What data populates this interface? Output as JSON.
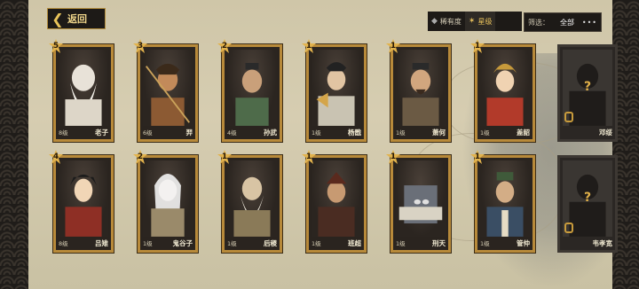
{
  "header": {
    "back_label": "返回",
    "sort_options": [
      {
        "label": "稀有度",
        "icon": "diamond-icon",
        "active": false
      },
      {
        "label": "星级",
        "icon": "star-icon",
        "active": true
      }
    ],
    "filter_label": "筛选：",
    "filter_value": "全部",
    "more_label": "•••"
  },
  "colors": {
    "accent": "#e8c15c",
    "card_frame": "#b88a3a",
    "star_badge": "#e2b34d",
    "panel_bg": "#d6cdb1"
  },
  "cards": [
    {
      "name": "老子",
      "level": "8级",
      "stars": "5",
      "locked": false
    },
    {
      "name": "羿",
      "level": "6级",
      "stars": "3",
      "locked": false
    },
    {
      "name": "孙武",
      "level": "4级",
      "stars": "2",
      "locked": false
    },
    {
      "name": "杨戬",
      "level": "1级",
      "stars": "1",
      "locked": false
    },
    {
      "name": "萧何",
      "level": "1级",
      "stars": "1",
      "locked": false
    },
    {
      "name": "盖韶",
      "level": "1级",
      "stars": "1",
      "locked": false
    },
    {
      "name": "邓绥",
      "level": "",
      "stars": "",
      "locked": true
    },
    {
      "name": "吕雉",
      "level": "8级",
      "stars": "4",
      "locked": false
    },
    {
      "name": "鬼谷子",
      "level": "1级",
      "stars": "2",
      "locked": false
    },
    {
      "name": "后稷",
      "level": "1级",
      "stars": "1",
      "locked": false
    },
    {
      "name": "班超",
      "level": "1级",
      "stars": "1",
      "locked": false
    },
    {
      "name": "刑天",
      "level": "1级",
      "stars": "1",
      "locked": false
    },
    {
      "name": "管仲",
      "level": "1级",
      "stars": "1",
      "locked": false
    },
    {
      "name": "韦孝宽",
      "level": "",
      "stars": "",
      "locked": true
    }
  ]
}
